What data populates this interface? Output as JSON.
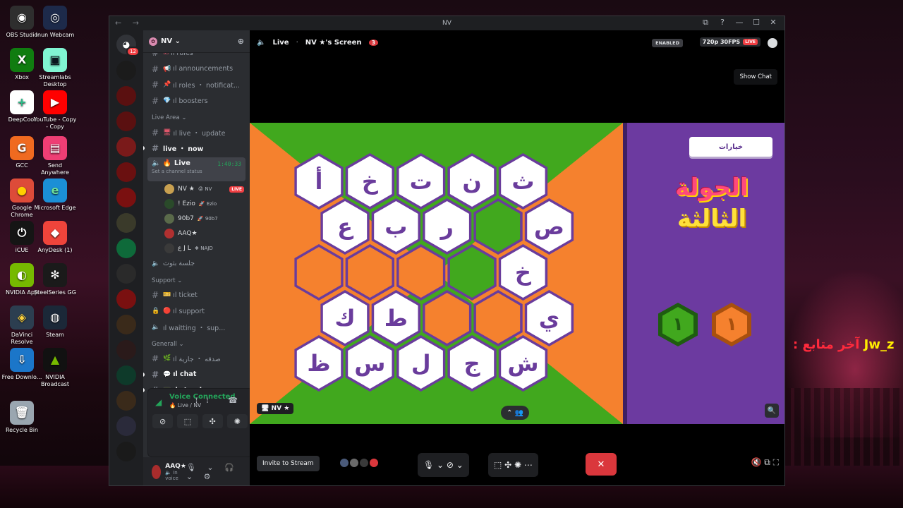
{
  "desktop": {
    "icons": [
      {
        "label": "OBS Studio",
        "glyph": "◉",
        "bg": "#2e2e2e",
        "fg": "#ffffff"
      },
      {
        "label": "Inun Webcam",
        "glyph": "◎",
        "bg": "#1d2a4a",
        "fg": "#ffffff"
      },
      {
        "label": "Xbox",
        "glyph": "X",
        "bg": "#107c10",
        "fg": "#ffffff"
      },
      {
        "label": "Streamlabs Desktop",
        "glyph": "▣",
        "bg": "#80f5d2",
        "fg": "#09161d"
      },
      {
        "label": "DeepCool",
        "glyph": "+",
        "bg": "#ffffff",
        "fg": "#2bbb88"
      },
      {
        "label": "YouTube - Copy - Copy",
        "glyph": "▶",
        "bg": "#ff0000",
        "fg": "#ffffff"
      },
      {
        "label": "GCC",
        "glyph": "G",
        "bg": "#f06a20",
        "fg": "#ffffff"
      },
      {
        "label": "Send Anywhere",
        "glyph": "▤",
        "bg": "#ee3e74",
        "fg": "#ffffff"
      },
      {
        "label": "Google Chrome",
        "glyph": "●",
        "bg": "#dd4b39",
        "fg": "#ffd000"
      },
      {
        "label": "Microsoft Edge",
        "glyph": "e",
        "bg": "#1b8fd6",
        "fg": "#6fe09a"
      },
      {
        "label": "iCUE",
        "glyph": "⏻",
        "bg": "#151515",
        "fg": "#ffffff"
      },
      {
        "label": "AnyDesk (1)",
        "glyph": "◆",
        "bg": "#ef443b",
        "fg": "#ffffff"
      },
      {
        "label": "NVIDIA App",
        "glyph": "◐",
        "bg": "#76b900",
        "fg": "#ffffff"
      },
      {
        "label": "SteelSeries GG",
        "glyph": "✻",
        "bg": "#1a1a1a",
        "fg": "#ffffff"
      },
      {
        "label": "DaVinci Resolve",
        "glyph": "◈",
        "bg": "#2c3e50",
        "fg": "#ffd33d"
      },
      {
        "label": "Steam",
        "glyph": "◍",
        "bg": "#1b2838",
        "fg": "#ffffff"
      },
      {
        "label": "Free Downlo...",
        "glyph": "⇩",
        "bg": "#1b76c9",
        "fg": "#ffffff"
      },
      {
        "label": "NVIDIA Broadcast",
        "glyph": "▲",
        "bg": "#111111",
        "fg": "#76b900"
      },
      {
        "label": "Recycle Bin",
        "glyph": "🗑",
        "bg": "#9aa6b0",
        "fg": "#ffffff"
      }
    ],
    "overlay_name": "Jw_z",
    "overlay_label": ": آخر متابع"
  },
  "window": {
    "title": "NV",
    "nav": "← →",
    "controls": [
      "⧉",
      "?",
      "—",
      "☐",
      "✕"
    ]
  },
  "guilds": {
    "home_badge": "12",
    "items": [
      "#1b1b1b",
      "#5a1010",
      "#5a1010",
      "#7a1a1a",
      "#6a1010",
      "#7a1010",
      "#3a3a2a",
      "#0e6a3a",
      "#2a2a2a",
      "#7a1010",
      "#3a2a1a",
      "#2a1a1a",
      "#0e3a2a",
      "#3a2a1a",
      "#2a2a3a",
      "#1a1a1a"
    ]
  },
  "server": {
    "name": "NV",
    "invite_icon": "person-add-icon"
  },
  "channels": [
    {
      "type": "text",
      "emoji": "☑",
      "name": "ıl rules"
    },
    {
      "type": "text",
      "emoji": "📢",
      "name": "ıl announcements"
    },
    {
      "type": "text",
      "emoji": "📌",
      "name": "ıl roles ・ notificat..."
    },
    {
      "type": "text",
      "emoji": "💎",
      "name": "ıl boosters"
    },
    {
      "type": "category",
      "name": "Live Area ⌄"
    },
    {
      "type": "text",
      "emoji": "🖥",
      "name": "ıl live ・ update"
    },
    {
      "type": "text-bold",
      "emoji": "",
      "name": "live ・ now"
    }
  ],
  "live_channel": {
    "name": "Live",
    "status": "Set a channel status",
    "time": "1:40:33"
  },
  "voice_users": [
    {
      "name": "NV ★",
      "tag": "😡 NV",
      "live": "LIVE",
      "color": "#c8a050"
    },
    {
      "name": "! Ezio",
      "tag": "🚀 Ezio",
      "live": "",
      "color": "#2a4a2a"
    },
    {
      "name": "90b7",
      "tag": "🚀 90b7",
      "live": "",
      "color": "#5a6a4a"
    },
    {
      "name": "AAQ★",
      "tag": "",
      "live": "",
      "color": "#b03030"
    },
    {
      "name": "ع J L",
      "tag": "❖ NAJD",
      "live": "",
      "color": "#3a3a3a"
    }
  ],
  "channels_after": [
    {
      "type": "voice",
      "emoji": "",
      "name": "جلسة بثوث"
    },
    {
      "type": "category",
      "name": "Support ⌄"
    },
    {
      "type": "text",
      "emoji": "🎫",
      "name": "ıl ticket"
    },
    {
      "type": "locked",
      "emoji": "🔴",
      "name": "ıl support"
    },
    {
      "type": "voice",
      "emoji": "",
      "name": "ıl waitting ・ sup..."
    },
    {
      "type": "category",
      "name": "Generall ⌄"
    },
    {
      "type": "text",
      "emoji": "🌿",
      "name": "ıl صدقه ・ جارية"
    },
    {
      "type": "text-bold",
      "emoji": "💬",
      "name": "ıl chat"
    },
    {
      "type": "text-bold",
      "emoji": "📟",
      "name": "ıl streak"
    }
  ],
  "voice_panel": {
    "title": "Voice Connected",
    "subtitle": "🔥 Live / NV",
    "buttons": [
      "⊘",
      "⬚",
      "✣",
      "✺"
    ]
  },
  "user_panel": {
    "name": "AAQ★",
    "status": "🔈 In voice",
    "tools": "🎙 ⌄ 🎧 ⌄ ⚙"
  },
  "stream_header": {
    "channel": "Live",
    "screen": "NV ★'s Screen",
    "count_badge": "3",
    "enabled": "ENABLED",
    "quality": "720p 30FPS",
    "live": "LIVE",
    "tooltip": "Show Chat"
  },
  "game": {
    "option_button": "خيارات",
    "round_line1": "الجولة",
    "round_line2": "الثالثة",
    "score_green": "١",
    "score_orange": "١",
    "colors": {
      "orange": "#f5812e",
      "green": "#41a81e",
      "purple": "#6b3b9e",
      "border": "#6a3c9c",
      "white": "#ffffff",
      "letter": "#6a3c9c"
    },
    "rows": [
      [
        "أ",
        "خ",
        "ت",
        "ن",
        "ث"
      ],
      [
        "ع",
        "ب",
        "ر",
        "",
        "ص"
      ],
      [
        "",
        "",
        "",
        "",
        "خ"
      ],
      [
        "ك",
        "ط",
        "",
        "",
        "ي"
      ],
      [
        "ظ",
        "س",
        "ل",
        "ج",
        "ش"
      ]
    ],
    "fills": [
      [
        "white",
        "white",
        "white",
        "white",
        "white"
      ],
      [
        "white",
        "white",
        "white",
        "green",
        "white"
      ],
      [
        "orange",
        "orange",
        "orange",
        "green",
        "white"
      ],
      [
        "white",
        "white",
        "orange",
        "orange",
        "white"
      ],
      [
        "white",
        "white",
        "white",
        "white",
        "white"
      ]
    ]
  },
  "stream_overlay": {
    "name_tag": "🖥 NV ★",
    "expand": "⌃ 👥",
    "zoom": "🔍"
  },
  "bottom_bar": {
    "invite": "Invite to Stream",
    "group1": "🎙 ⌄ ⊘ ⌄",
    "group2": "⬚ ✣ ✺ ⋯",
    "leave": "✕",
    "right": "🔇 ⧉ ⛶"
  }
}
